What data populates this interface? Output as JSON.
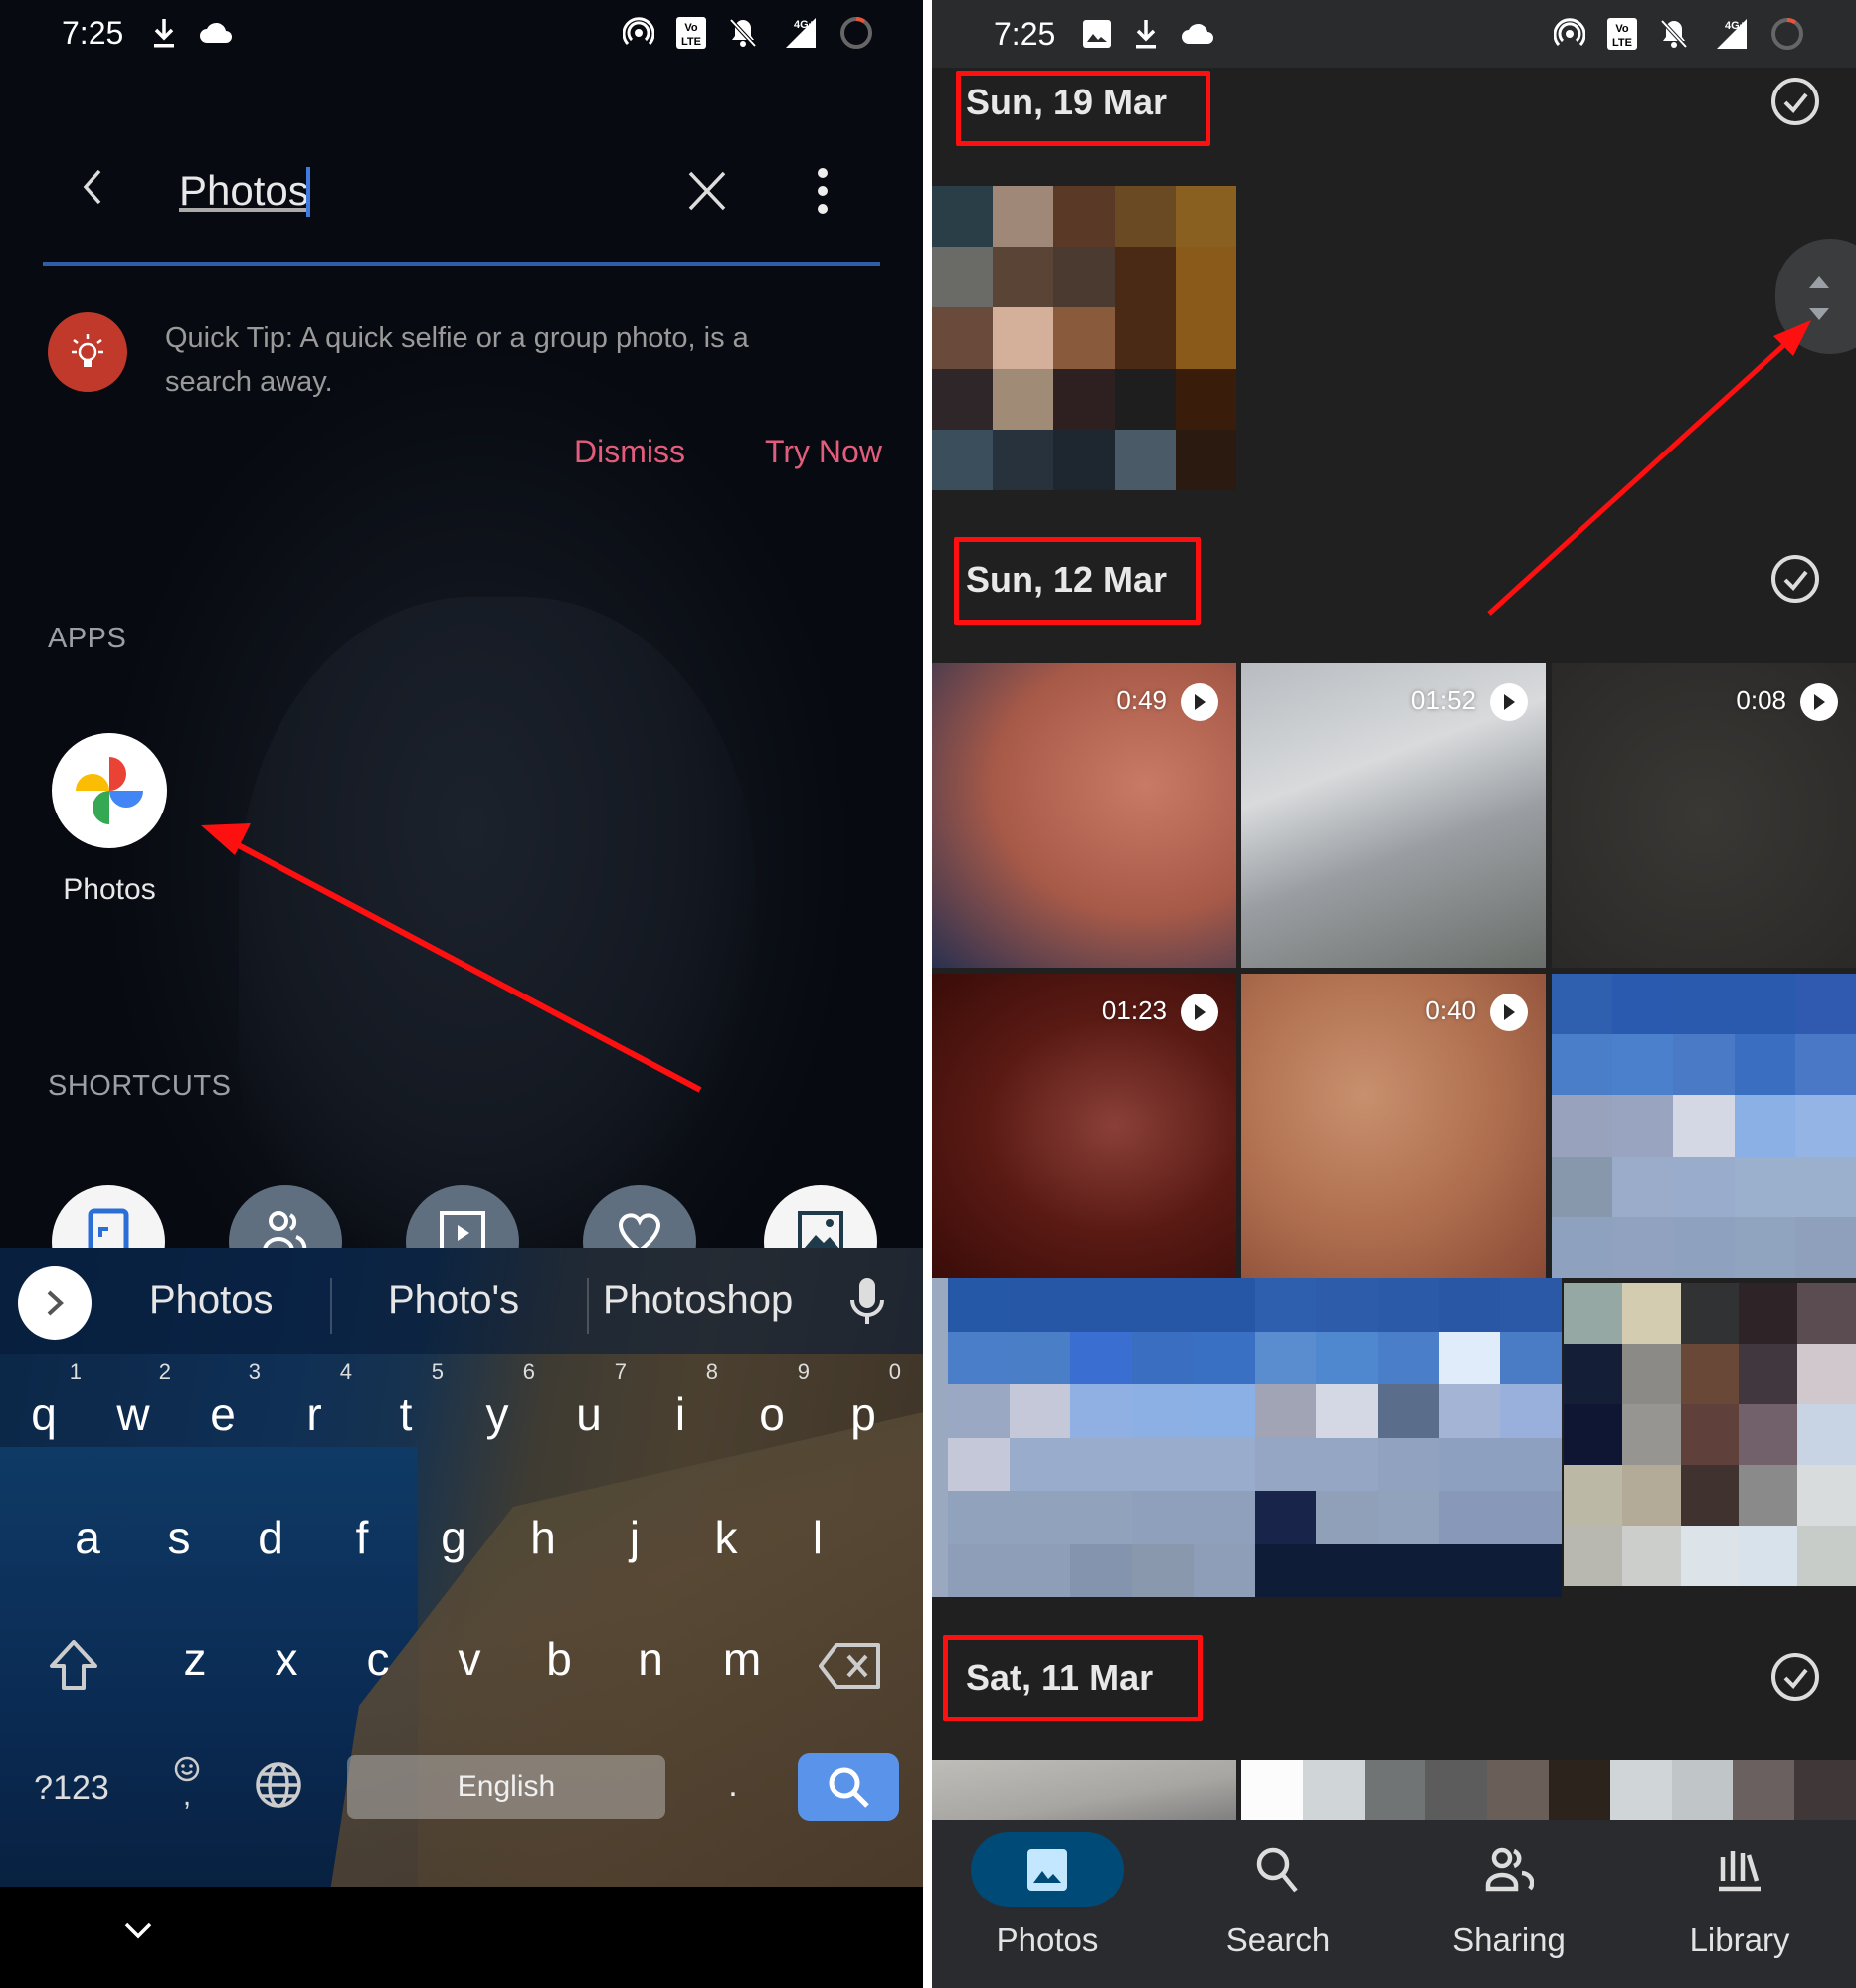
{
  "left": {
    "status_bar": {
      "time": "7:25",
      "left_icons": [
        "download-icon",
        "cloud-icon"
      ],
      "right_icons": [
        "hotspot-icon",
        "volte-icon",
        "notifications-off-icon",
        "signal-4g-icon",
        "battery-ring-icon"
      ]
    },
    "search": {
      "value": "Photos",
      "back_icon": "chevron-left-icon",
      "clear_icon": "close-icon",
      "more_icon": "more-vert-icon"
    },
    "quick_tip": {
      "icon": "lightbulb-icon",
      "text": "Quick Tip: A quick selfie or a group photo, is a search away.",
      "dismiss_label": "Dismiss",
      "try_label": "Try Now",
      "accent_color": "#e25c7b"
    },
    "apps_section": {
      "heading": "APPS",
      "apps": [
        {
          "label": "Photos",
          "icon": "google-photos-icon"
        }
      ]
    },
    "shortcuts_section": {
      "heading": "SHORTCUTS",
      "items": [
        {
          "icon": "photo-frame-icon"
        },
        {
          "icon": "people-icon"
        },
        {
          "icon": "video-icon"
        },
        {
          "icon": "heart-icon"
        },
        {
          "icon": "image-icon"
        }
      ]
    },
    "keyboard": {
      "suggestions": [
        "Photos",
        "Photo's",
        "Photoshop"
      ],
      "row1": [
        {
          "key": "q",
          "hint": "1"
        },
        {
          "key": "w",
          "hint": "2"
        },
        {
          "key": "e",
          "hint": "3"
        },
        {
          "key": "r",
          "hint": "4"
        },
        {
          "key": "t",
          "hint": "5"
        },
        {
          "key": "y",
          "hint": "6"
        },
        {
          "key": "u",
          "hint": "7"
        },
        {
          "key": "i",
          "hint": "8"
        },
        {
          "key": "o",
          "hint": "9"
        },
        {
          "key": "p",
          "hint": "0"
        }
      ],
      "row2": [
        "a",
        "s",
        "d",
        "f",
        "g",
        "h",
        "j",
        "k",
        "l"
      ],
      "row3": [
        "z",
        "x",
        "c",
        "v",
        "b",
        "n",
        "m"
      ],
      "symbols_label": "?123",
      "comma_label": ",",
      "space_label": "English",
      "period_label": ".",
      "action_color": "#5a93ea"
    }
  },
  "right": {
    "status_bar": {
      "time": "7:25",
      "left_icons": [
        "image-icon",
        "download-icon",
        "cloud-icon"
      ],
      "right_icons": [
        "hotspot-icon",
        "volte-icon",
        "notifications-off-icon",
        "signal-4g-icon",
        "battery-ring-icon"
      ]
    },
    "sections": [
      {
        "date": "Sun, 19 Mar",
        "highlighted": true
      },
      {
        "date": "Sun, 12 Mar",
        "highlighted": true
      },
      {
        "date": "Sat, 11 Mar",
        "highlighted": true
      }
    ],
    "videos": [
      {
        "duration": "0:49"
      },
      {
        "duration": "01:52"
      },
      {
        "duration": "0:08"
      },
      {
        "duration": "01:23"
      },
      {
        "duration": "0:40"
      }
    ],
    "bottom_nav": {
      "items": [
        {
          "label": "Photos",
          "icon": "photos-icon",
          "active": true
        },
        {
          "label": "Search",
          "icon": "search-icon",
          "active": false
        },
        {
          "label": "Sharing",
          "icon": "sharing-icon",
          "active": false
        },
        {
          "label": "Library",
          "icon": "library-icon",
          "active": false
        }
      ],
      "active_color": "#004a77"
    },
    "annotation_color": "#ff1010"
  }
}
